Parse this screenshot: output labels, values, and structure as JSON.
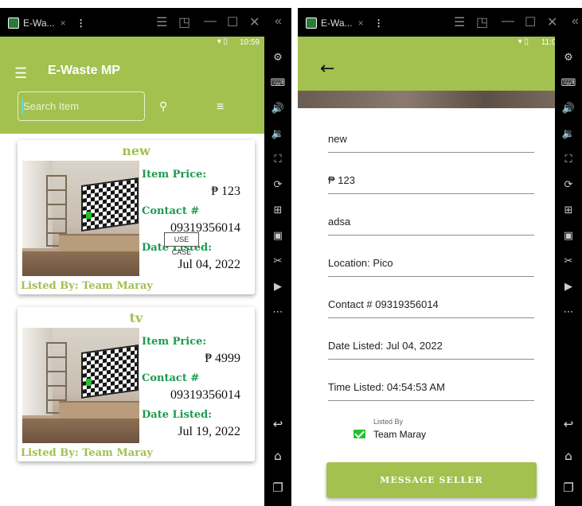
{
  "left": {
    "window": {
      "tab_label": "E-Wa...",
      "tab_close": "×",
      "menu": "⋮",
      "controls": [
        "☰",
        "◳",
        "—",
        "☐",
        "✕"
      ],
      "collapse": "«"
    },
    "status": {
      "time": "10:59"
    },
    "app": {
      "title": "E-Waste MP",
      "search_placeholder": "Search Item"
    },
    "labels": {
      "item_price": "Item Price:",
      "contact": "Contact #",
      "date_listed": "Date Listed:"
    },
    "items": [
      {
        "title": "new",
        "price": "₱ 123",
        "contact": "09319356014",
        "date": "Jul 04, 2022",
        "listed_by": "Listed By: Team Maray"
      },
      {
        "title": "tv",
        "price": "₱ 4999",
        "contact": "09319356014",
        "date": "Jul 19, 2022",
        "listed_by": "Listed By: Team Maray"
      }
    ],
    "tooltip": "USE CASE"
  },
  "right": {
    "window": {
      "tab_label": "E-Wa...",
      "tab_close": "×",
      "menu": "⋮",
      "controls": [
        "☰",
        "◳",
        "—",
        "☐",
        "✕"
      ],
      "collapse": "«"
    },
    "status": {
      "time": "11:03"
    },
    "fields": {
      "name": "new",
      "price": "₱ 123",
      "description": "adsa",
      "location": "Location: Pico",
      "contact": "Contact # 09319356014",
      "date_listed": "Date Listed: Jul 04, 2022",
      "time_listed": "Time Listed: 04:54:53 AM"
    },
    "listed_by": {
      "label": "Listed By",
      "name": "Team Maray"
    },
    "button": "MESSAGE SELLER"
  },
  "sidebar_icons": [
    "settings-icon",
    "keyboard-icon",
    "volume-up-icon",
    "volume-down-icon",
    "fullscreen-icon",
    "rotate-icon",
    "add-icon",
    "apk-icon",
    "scissors-icon",
    "video-icon",
    "more-icon",
    "back-icon",
    "home-icon",
    "recents-icon"
  ],
  "colors": {
    "accent": "#a2c14f",
    "label_green": "#1d9a52"
  }
}
